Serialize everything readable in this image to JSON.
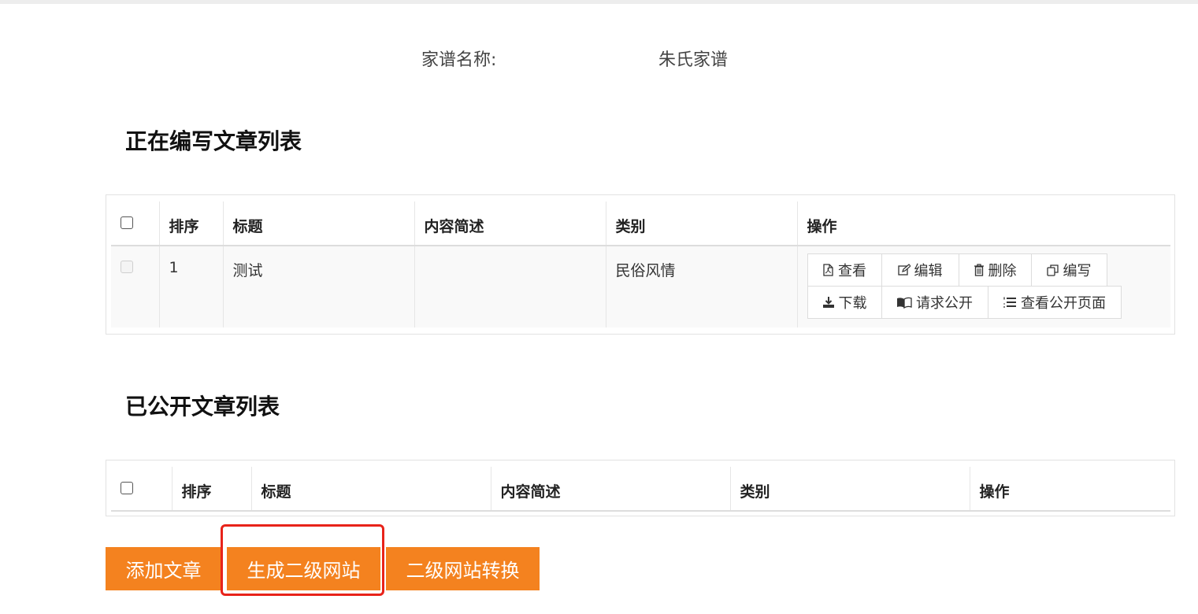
{
  "genealogy": {
    "label": "家谱名称:",
    "value": "朱氏家谱"
  },
  "drafts": {
    "title": "正在编写文章列表",
    "headers": {
      "order": "排序",
      "title": "标题",
      "summary": "内容简述",
      "category": "类别",
      "actions": "操作"
    },
    "rows": [
      {
        "order": "1",
        "title": "测试",
        "summary": "",
        "category": "民俗风情",
        "actions": [
          "查看",
          "编辑",
          "删除",
          "编写",
          "下载",
          "请求公开",
          "查看公开页面"
        ]
      }
    ]
  },
  "published": {
    "title": "已公开文章列表",
    "headers": {
      "order": "排序",
      "title": "标题",
      "summary": "内容简述",
      "category": "类别",
      "actions": "操作"
    }
  },
  "buttons": {
    "add_article": "添加文章",
    "generate_site": "生成二级网站",
    "site_convert": "二级网站转换"
  },
  "colors": {
    "accent": "#f4821f",
    "highlight": "#e8231a"
  }
}
